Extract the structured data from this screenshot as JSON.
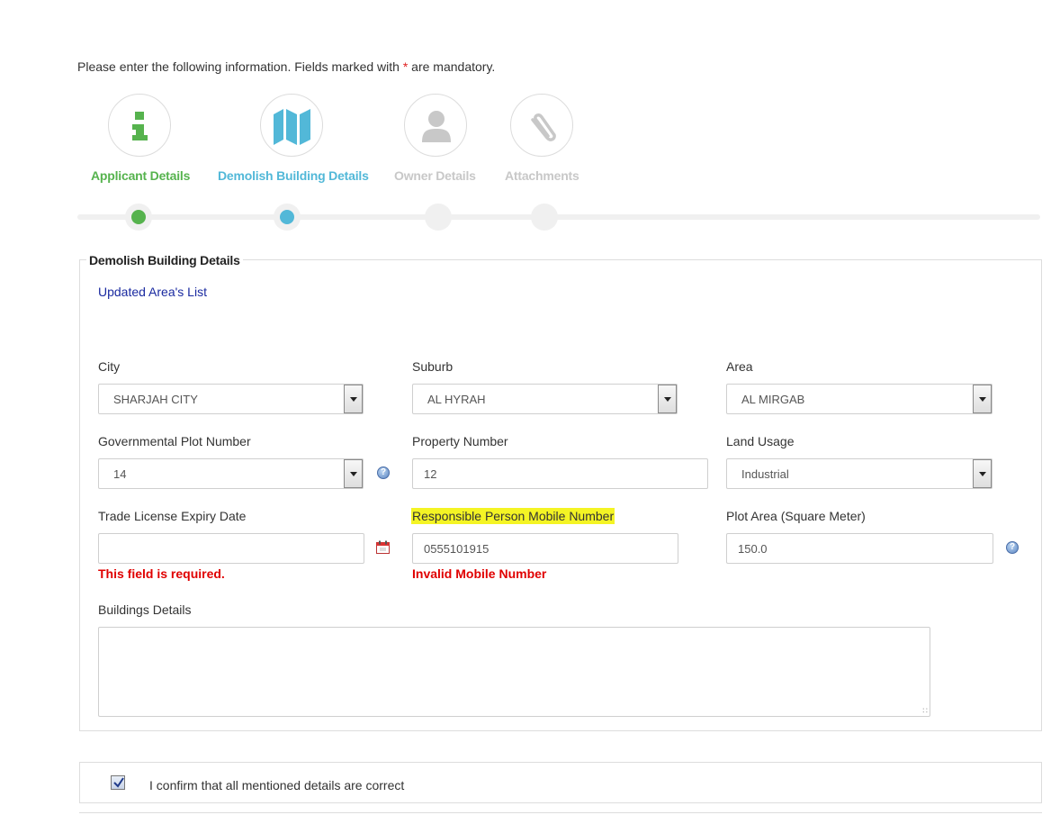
{
  "intro": {
    "text_before": "Please enter the following information. Fields marked with ",
    "star": "*",
    "text_after": " are mandatory."
  },
  "wizard": {
    "steps": [
      {
        "label": "Applicant Details",
        "icon": "info-icon",
        "state": "complete",
        "color": "#56b34e"
      },
      {
        "label": "Demolish Building Details",
        "icon": "map-icon",
        "state": "active",
        "color": "#52b8d8"
      },
      {
        "label": "Owner Details",
        "icon": "user-icon",
        "state": "pending",
        "color": "#c8c8c8"
      },
      {
        "label": "Attachments",
        "icon": "paperclip-icon",
        "state": "pending",
        "color": "#c8c8c8"
      }
    ]
  },
  "section": {
    "legend": "Demolish Building Details",
    "link": "Updated Area's List"
  },
  "form": {
    "city": {
      "label": "City",
      "value": "SHARJAH CITY"
    },
    "suburb": {
      "label": "Suburb",
      "value": "AL HYRAH"
    },
    "area": {
      "label": "Area",
      "value": "AL MIRGAB"
    },
    "gov_plot": {
      "label": "Governmental Plot Number",
      "value": "14"
    },
    "property_number": {
      "label": "Property Number",
      "value": "12"
    },
    "land_usage": {
      "label": "Land Usage",
      "value": "Industrial"
    },
    "trade_license": {
      "label": "Trade License Expiry Date",
      "value": "",
      "error": "This field is required."
    },
    "mobile": {
      "label": "Responsible Person Mobile Number",
      "value": "0555101915",
      "error": "Invalid Mobile Number"
    },
    "plot_area": {
      "label": "Plot Area (Square Meter)",
      "value": "150.0"
    },
    "buildings_details": {
      "label": "Buildings Details",
      "value": ""
    }
  },
  "confirm": {
    "checked": true,
    "text": "I confirm that all mentioned details are correct"
  },
  "colors": {
    "error": "#e00000",
    "link": "#1a2aa0",
    "highlight": "#f4f424",
    "step_complete": "#56b34e",
    "step_active": "#52b8d8"
  }
}
